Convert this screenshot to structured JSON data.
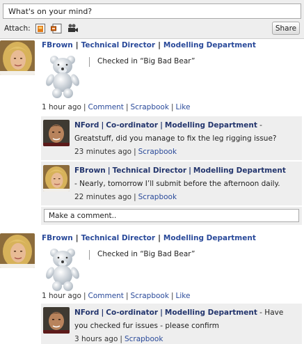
{
  "composer": {
    "placeholder": "What's on your mind?",
    "attach_label": "Attach:",
    "attach_icons": [
      "photo-icon",
      "link-icon",
      "video-camera-icon"
    ],
    "share_label": "Share"
  },
  "posts": [
    {
      "author": "FBrown",
      "role": "Technical Director",
      "department": "Modelling Department",
      "checkin": "Checked in “Big Bad Bear”",
      "time": "1 hour ago",
      "actions": [
        "Comment",
        "Scrapbook",
        "Like"
      ],
      "comments": [
        {
          "author": "NFord",
          "role": "Co-ordinator",
          "department": "Modelling Department",
          "text": " - Greatstuff, did you manage to fix the leg rigging issue?",
          "time": "23 minutes ago",
          "action": "Scrapbook"
        },
        {
          "author": "FBrown",
          "role": "Technical Director",
          "department": "Modelling Department",
          "text": "- Nearly, tomorrow I’ll submit before the afternoon daily.",
          "time": "22 minutes ago",
          "action": "Scrapbook"
        }
      ],
      "comment_placeholder": "Make a comment.."
    },
    {
      "author": "FBrown",
      "role": "Technical Director",
      "department": "Modelling Department",
      "checkin": "Checked in “Big Bad Bear”",
      "time": "1 hour ago",
      "actions": [
        "Comment",
        "Scrapbook",
        "Like"
      ],
      "comments": [
        {
          "author": "NFord",
          "role": "Co-ordinator",
          "department": "Modelling Department",
          "text": " - Have you checked fur issues - please confirm",
          "time": "3 hours ago",
          "action": "Scrapbook"
        }
      ]
    }
  ],
  "colors": {
    "link": "#2a4a9a",
    "author": "#23356d",
    "comment_bg": "#eeeeee"
  }
}
